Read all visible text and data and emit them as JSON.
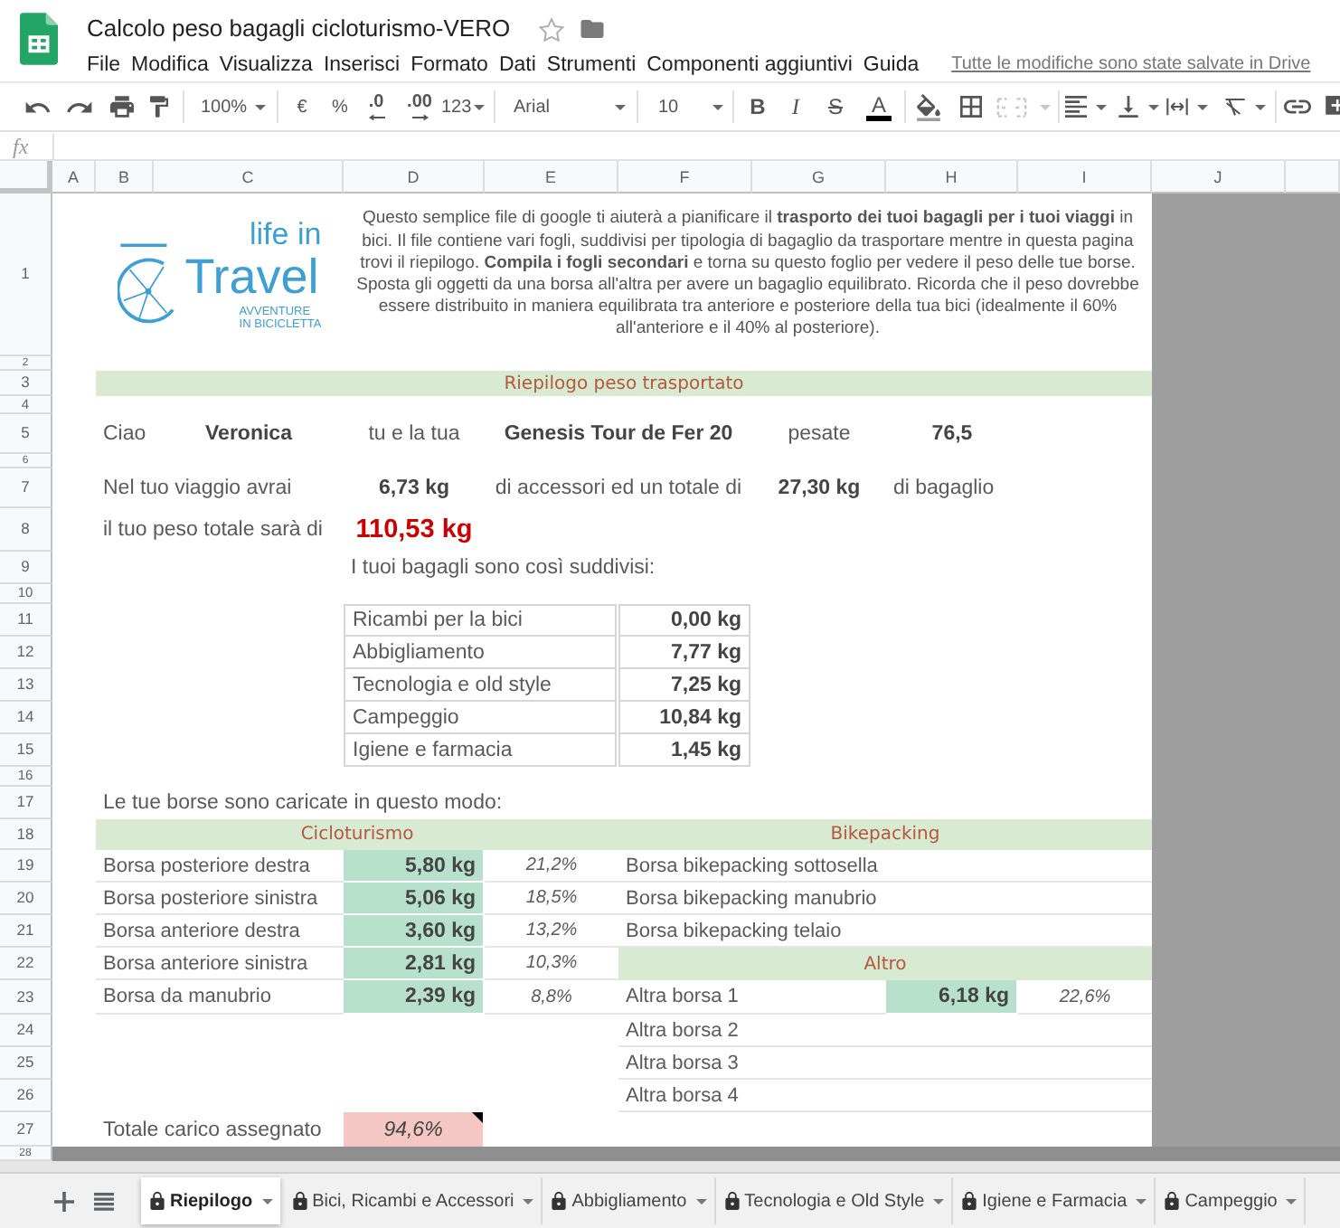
{
  "document": {
    "title": "Calcolo peso bagagli cicloturismo-VERO",
    "starred": false,
    "menu": [
      "File",
      "Modifica",
      "Visualizza",
      "Inserisci",
      "Formato",
      "Dati",
      "Strumenti",
      "Componenti aggiuntivi",
      "Guida"
    ],
    "save_status": "Tutte le modifiche sono state salvate in Drive"
  },
  "toolbar": {
    "zoom": "100%",
    "currency": "€",
    "percent": "%",
    "fewer_decimals": ".0",
    "more_decimals": ".00",
    "number_format": "123",
    "font": "Arial",
    "font_size": "10",
    "bold": "B",
    "italic": "I",
    "strikethrough": "S",
    "text_color": "A"
  },
  "formula_bar": {
    "label": "fx"
  },
  "columns": [
    "A",
    "B",
    "C",
    "D",
    "E",
    "F",
    "G",
    "H",
    "I",
    "J"
  ],
  "rows": [
    "1",
    "2",
    "3",
    "4",
    "5",
    "6",
    "7",
    "8",
    "9",
    "10",
    "11",
    "12",
    "13",
    "14",
    "15",
    "16",
    "17",
    "18",
    "19",
    "20",
    "21",
    "22",
    "23",
    "24",
    "25",
    "26",
    "27",
    "28"
  ],
  "intro": {
    "logo": {
      "line_1": "life in",
      "line_2": "Travel",
      "tagline": [
        "AVVENTURE",
        "IN BICICLETTA"
      ]
    },
    "text": "Questo semplice file di google ti aiuterà a pianificare il **trasporto dei tuoi bagagli per i tuoi viaggi** in bici. Il file contiene vari fogli, suddivisi per tipologia di bagaglio da trasportare mentre in questa pagina trovi il riepilogo. **Compila i fogli secondari** e torna su questo foglio per vedere il peso delle tue borse. Sposta gli oggetti da una borsa all'altra per avere un bagaglio equilibrato. Ricorda che il peso dovrebbe essere distribuito in maniera equilibrata tra anteriore e posteriore della tua bici (idealmente il 60% all'anteriore e il 40% al posteriore)."
  },
  "summary": {
    "title": "Riepilogo peso trasportato",
    "greeting": "Ciao",
    "name": "Veronica",
    "bike_intro": "tu e la tua",
    "bike": "Genesis Tour de Fer 20",
    "weight_intro": "pesate",
    "body_weight": "76,5",
    "trip_intro": "Nel tuo viaggio avrai",
    "accessories_weight": "6,73 kg",
    "accessories_label": "di accessori ed un totale di",
    "luggage_weight": "27,30 kg",
    "luggage_label": "di bagaglio",
    "total_label": "il tuo peso totale sarà di",
    "total_weight": "110,53 kg"
  },
  "categories": {
    "title": "I tuoi bagagli sono così suddivisi:",
    "items": [
      {
        "name": "Ricambi per la bici",
        "weight": "0,00 kg"
      },
      {
        "name": "Abbigliamento",
        "weight": "7,77 kg"
      },
      {
        "name": "Tecnologia e old style",
        "weight": "7,25 kg"
      },
      {
        "name": "Campeggio",
        "weight": "10,84 kg"
      },
      {
        "name": "Igiene e farmacia",
        "weight": "1,45 kg"
      }
    ]
  },
  "bags": {
    "title": "Le tue borse sono caricate in questo modo:",
    "groups": [
      {
        "name": "Cicloturismo",
        "items": [
          {
            "name": "Borsa posteriore destra",
            "weight": "5,80 kg",
            "share": "21,2%"
          },
          {
            "name": "Borsa posteriore sinistra",
            "weight": "5,06 kg",
            "share": "18,5%"
          },
          {
            "name": "Borsa anteriore destra",
            "weight": "3,60 kg",
            "share": "13,2%"
          },
          {
            "name": "Borsa anteriore sinistra",
            "weight": "2,81 kg",
            "share": "10,3%"
          },
          {
            "name": "Borsa da manubrio",
            "weight": "2,39 kg",
            "share": "8,8%"
          }
        ]
      },
      {
        "name": "Bikepacking",
        "items": [
          {
            "name": "Borsa bikepacking sottosella"
          },
          {
            "name": "Borsa bikepacking manubrio"
          },
          {
            "name": "Borsa bikepacking telaio"
          }
        ]
      },
      {
        "name": "Altro",
        "items": [
          {
            "name": "Altra borsa 1",
            "weight": "6,18 kg",
            "share": "22,6%"
          },
          {
            "name": "Altra borsa 2"
          },
          {
            "name": "Altra borsa 3"
          },
          {
            "name": "Altra borsa 4"
          }
        ]
      }
    ],
    "total": {
      "label": "Totale carico assegnato",
      "value": "94,6%",
      "complete": false,
      "has_note": true
    }
  },
  "sheet_tabs": [
    {
      "label": "Riepilogo",
      "selected": true,
      "locked": true
    },
    {
      "label": "Bici, Ricambi e Accessori",
      "selected": false,
      "locked": true
    },
    {
      "label": "Abbigliamento",
      "selected": false,
      "locked": true
    },
    {
      "label": "Tecnologia e Old Style",
      "selected": false,
      "locked": true
    },
    {
      "label": "Igiene e Farmacia",
      "selected": false,
      "locked": true
    },
    {
      "label": "Campeggio",
      "selected": false,
      "locked": true
    }
  ]
}
